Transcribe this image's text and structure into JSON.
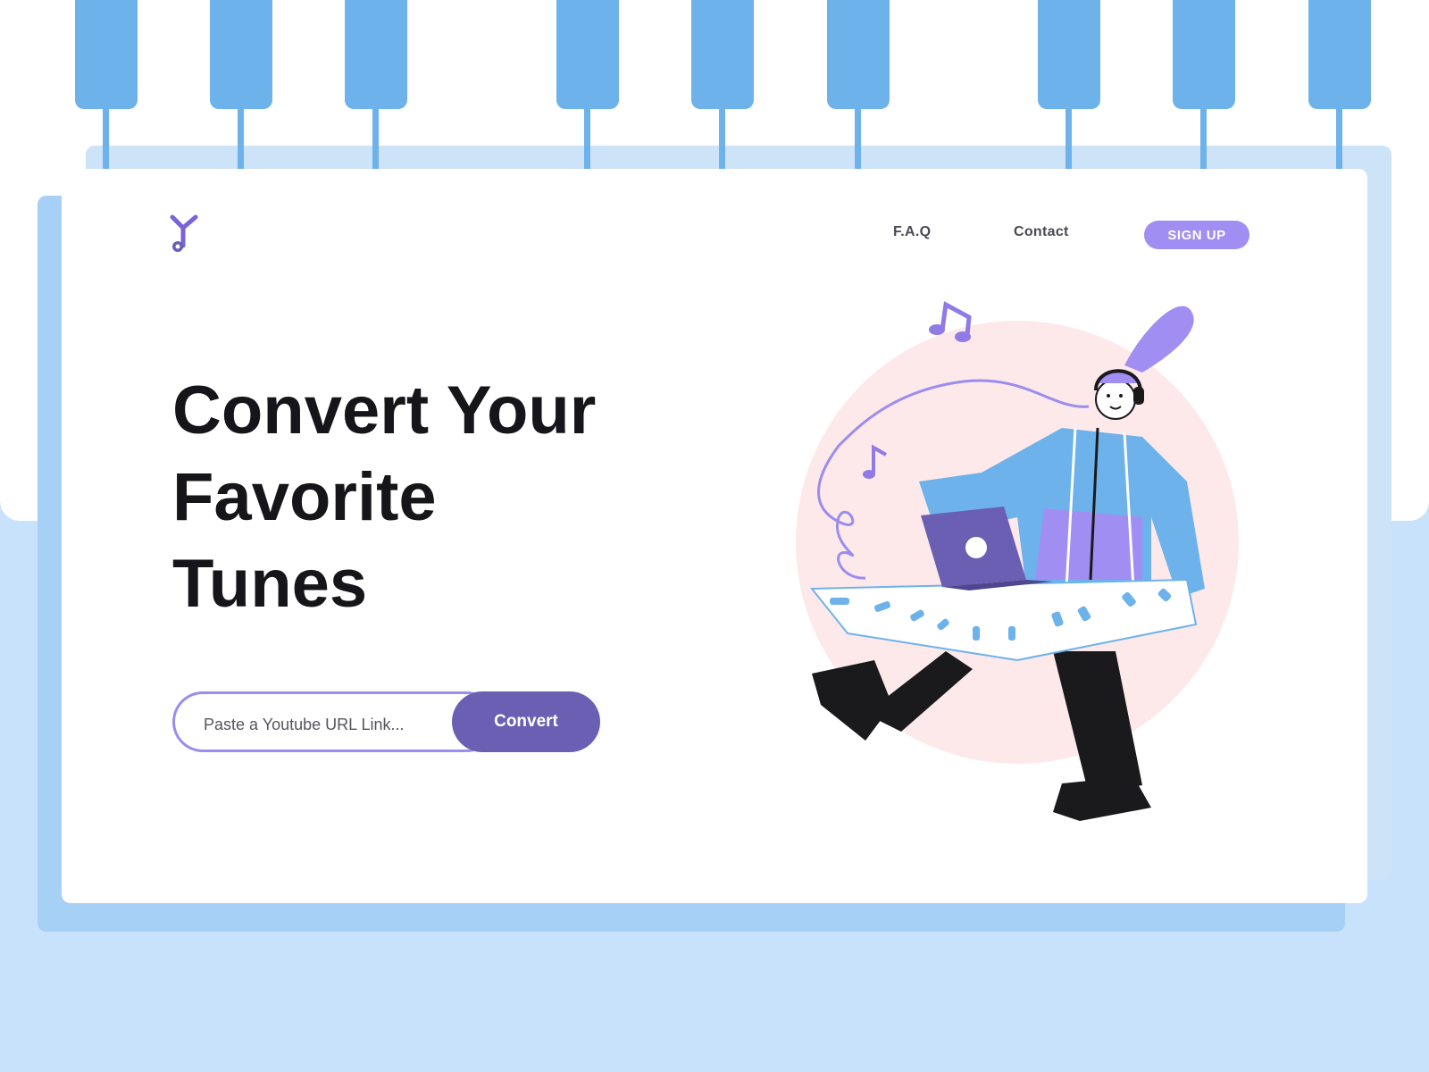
{
  "nav": {
    "faq_label": "F.A.Q",
    "contact_label": "Contact",
    "signup_label": "SIGN UP"
  },
  "hero": {
    "title_lines": [
      "Convert Your",
      "Favorite",
      "Tunes"
    ]
  },
  "converter": {
    "placeholder": "Paste a Youtube URL Link...",
    "button_label": "Convert"
  },
  "icons": {
    "logo": "music-note-logo-icon",
    "illustration": "musician-with-laptop-and-keyboard"
  },
  "colors": {
    "accent": "#a18ef3",
    "button": "#6a5fb3",
    "sky": "#6db2ea",
    "page_bg": "#c8e2fb"
  }
}
